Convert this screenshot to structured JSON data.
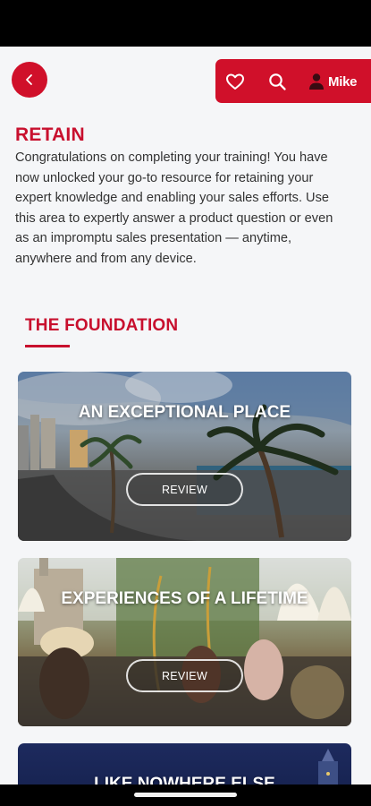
{
  "header": {
    "back_icon": "chevron-left-icon",
    "favorites_icon": "heart-icon",
    "search_icon": "search-icon",
    "user_icon": "person-icon",
    "user_name": "Mike",
    "accent_color": "#d0102a"
  },
  "page": {
    "title": "RETAIN",
    "intro": "Congratulations on completing your training! You have now unlocked your go-to resource for retaining your expert knowledge and enabling your sales efforts. Use this area to expertly answer a product question or even as an impromptu sales presentation — anytime, anywhere and from any device."
  },
  "section": {
    "title": "THE FOUNDATION"
  },
  "cards": [
    {
      "title": "AN EXCEPTIONAL PLACE",
      "button": "REVIEW"
    },
    {
      "title": "EXPERIENCES OF A LIFETIME",
      "button": "REVIEW"
    },
    {
      "title": "LIKE NOWHERE ELSE"
    }
  ]
}
